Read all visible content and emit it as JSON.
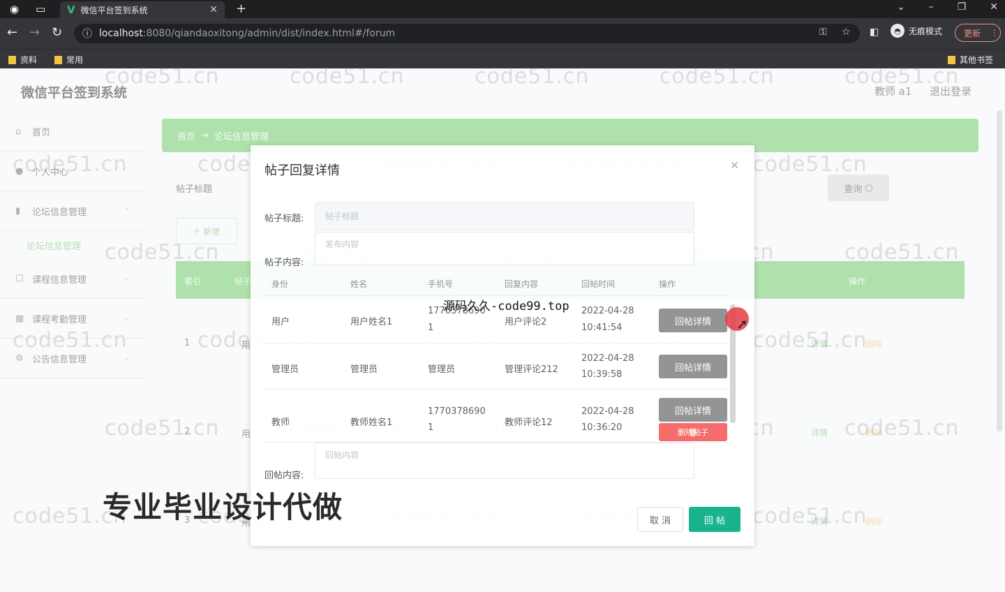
{
  "browser": {
    "tab_title": "微信平台签到系统",
    "url_host": "localhost",
    "url_rest": ":8080/qiandaoxitong/admin/dist/index.html#/forum",
    "incognito_label": "无痕模式",
    "update_label": "更新",
    "bookmarks": [
      "资料",
      "常用"
    ],
    "other_bookmarks": "其他书签"
  },
  "header": {
    "title": "微信平台签到系统",
    "user": "教师 a1",
    "logout": "退出登录"
  },
  "sidebar": {
    "items": [
      {
        "label": "首页",
        "icon": "home-icon"
      },
      {
        "label": "个人中心",
        "icon": "user-icon"
      },
      {
        "label": "论坛信息管理",
        "icon": "chart-icon"
      },
      {
        "label": "课程信息管理",
        "icon": "box-icon"
      },
      {
        "label": "课程考勤管理",
        "icon": "grid-icon"
      },
      {
        "label": "公告信息管理",
        "icon": "gear-icon"
      }
    ],
    "sub_item": "论坛信息管理"
  },
  "breadcrumb": {
    "home": "首页",
    "arrow": "→",
    "current": "论坛信息管理"
  },
  "filter": {
    "label": "帖子标题",
    "query": "查询"
  },
  "toolbar": {
    "add": "新增"
  },
  "table": {
    "headers": [
      "索引",
      "帖子标题",
      "操作"
    ],
    "rows": [
      {
        "index": "1",
        "cell": "用",
        "detail": "详情",
        "delete": "删除"
      },
      {
        "index": "2",
        "cell": "用",
        "detail": "详情",
        "delete": "删除"
      },
      {
        "index": "3",
        "cell": "用",
        "detail": "详情",
        "delete": "删除"
      }
    ]
  },
  "dialog": {
    "title": "帖子回复详情",
    "post_title_label": "帖子标题:",
    "post_title_placeholder": "帖子标题",
    "post_content_label": "帖子内容:",
    "post_content_placeholder": "发布内容",
    "reply_headers": [
      "身份",
      "姓名",
      "手机号",
      "回复内容",
      "回帖时间",
      "操作"
    ],
    "replies": [
      {
        "role": "用户",
        "name": "用户姓名1",
        "phone_a": "1770378690",
        "phone_b": "1",
        "content": "用户评论2",
        "date": "2022-04-28",
        "time": "10:41:54",
        "action": "回帖详情"
      },
      {
        "role": "管理员",
        "name": "管理员",
        "phone_a": "管理员",
        "phone_b": "",
        "content": "管理评论212",
        "date": "2022-04-28",
        "time": "10:39:58",
        "action": "回帖详情"
      },
      {
        "role": "教师",
        "name": "教师姓名1",
        "phone_a": "1770378690",
        "phone_b": "1",
        "content": "教师评论12",
        "date": "2022-04-28",
        "time": "10:36:20",
        "action": "回帖详情",
        "delete": "删除帖子"
      }
    ],
    "reply_content_label": "回帖内容:",
    "reply_content_placeholder": "回帖内容",
    "cancel": "取 消",
    "submit": "回 帖"
  },
  "overlay_text": "源码久久-code99.top",
  "promo_text": "专业毕业设计代做",
  "watermark": "code51.cn"
}
